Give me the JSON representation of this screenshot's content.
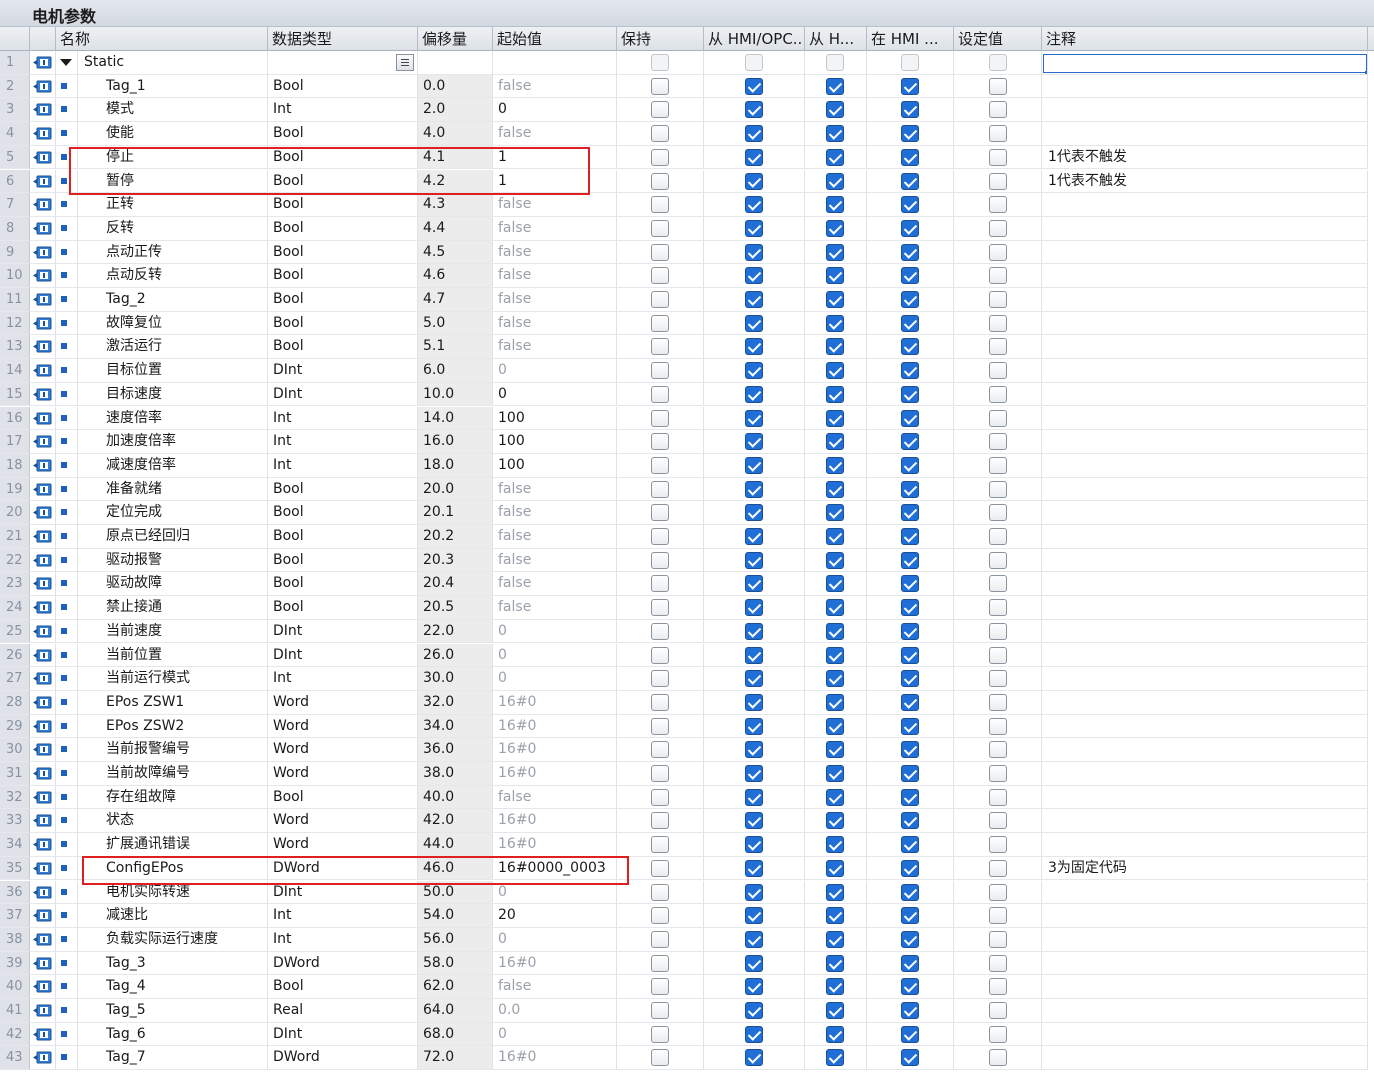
{
  "window": {
    "title": "电机参数"
  },
  "columns": {
    "name": "名称",
    "type": "数据类型",
    "offset": "偏移量",
    "start": "起始值",
    "retain": "保持",
    "hmi_access": "从 HMI/OPC..",
    "hmi_write": "从 H...",
    "hmi_visible": "在 HMI ...",
    "setpoint": "设定值",
    "comment": "注释"
  },
  "section_row": {
    "num": "1",
    "name": "Static"
  },
  "rows": [
    {
      "num": "2",
      "name": "Tag_1",
      "type": "Bool",
      "offset": "0.0",
      "start": "false",
      "comment": ""
    },
    {
      "num": "3",
      "name": "模式",
      "type": "Int",
      "offset": "2.0",
      "start": "0",
      "comment": ""
    },
    {
      "num": "4",
      "name": "使能",
      "type": "Bool",
      "offset": "4.0",
      "start": "false",
      "comment": ""
    },
    {
      "num": "5",
      "name": "停止",
      "type": "Bool",
      "offset": "4.1",
      "start": "1",
      "comment": "1代表不触发"
    },
    {
      "num": "6",
      "name": "暂停",
      "type": "Bool",
      "offset": "4.2",
      "start": "1",
      "comment": "1代表不触发"
    },
    {
      "num": "7",
      "name": "正转",
      "type": "Bool",
      "offset": "4.3",
      "start": "false",
      "comment": ""
    },
    {
      "num": "8",
      "name": "反转",
      "type": "Bool",
      "offset": "4.4",
      "start": "false",
      "comment": ""
    },
    {
      "num": "9",
      "name": "点动正传",
      "type": "Bool",
      "offset": "4.5",
      "start": "false",
      "comment": ""
    },
    {
      "num": "10",
      "name": "点动反转",
      "type": "Bool",
      "offset": "4.6",
      "start": "false",
      "comment": ""
    },
    {
      "num": "11",
      "name": "Tag_2",
      "type": "Bool",
      "offset": "4.7",
      "start": "false",
      "comment": ""
    },
    {
      "num": "12",
      "name": "故障复位",
      "type": "Bool",
      "offset": "5.0",
      "start": "false",
      "comment": ""
    },
    {
      "num": "13",
      "name": "激活运行",
      "type": "Bool",
      "offset": "5.1",
      "start": "false",
      "comment": ""
    },
    {
      "num": "14",
      "name": "目标位置",
      "type": "DInt",
      "offset": "6.0",
      "start": "0",
      "comment": ""
    },
    {
      "num": "15",
      "name": "目标速度",
      "type": "DInt",
      "offset": "10.0",
      "start": "0",
      "comment": ""
    },
    {
      "num": "16",
      "name": "速度倍率",
      "type": "Int",
      "offset": "14.0",
      "start": "100",
      "comment": ""
    },
    {
      "num": "17",
      "name": "加速度倍率",
      "type": "Int",
      "offset": "16.0",
      "start": "100",
      "comment": ""
    },
    {
      "num": "18",
      "name": "减速度倍率",
      "type": "Int",
      "offset": "18.0",
      "start": "100",
      "comment": ""
    },
    {
      "num": "19",
      "name": "准备就绪",
      "type": "Bool",
      "offset": "20.0",
      "start": "false",
      "comment": ""
    },
    {
      "num": "20",
      "name": "定位完成",
      "type": "Bool",
      "offset": "20.1",
      "start": "false",
      "comment": ""
    },
    {
      "num": "21",
      "name": "原点已经回归",
      "type": "Bool",
      "offset": "20.2",
      "start": "false",
      "comment": ""
    },
    {
      "num": "22",
      "name": "驱动报警",
      "type": "Bool",
      "offset": "20.3",
      "start": "false",
      "comment": ""
    },
    {
      "num": "23",
      "name": "驱动故障",
      "type": "Bool",
      "offset": "20.4",
      "start": "false",
      "comment": ""
    },
    {
      "num": "24",
      "name": "禁止接通",
      "type": "Bool",
      "offset": "20.5",
      "start": "false",
      "comment": ""
    },
    {
      "num": "25",
      "name": "当前速度",
      "type": "DInt",
      "offset": "22.0",
      "start": "0",
      "comment": ""
    },
    {
      "num": "26",
      "name": "当前位置",
      "type": "DInt",
      "offset": "26.0",
      "start": "0",
      "comment": ""
    },
    {
      "num": "27",
      "name": "当前运行模式",
      "type": "Int",
      "offset": "30.0",
      "start": "0",
      "comment": ""
    },
    {
      "num": "28",
      "name": "EPos ZSW1",
      "type": "Word",
      "offset": "32.0",
      "start": "16#0",
      "comment": ""
    },
    {
      "num": "29",
      "name": "EPos ZSW2",
      "type": "Word",
      "offset": "34.0",
      "start": "16#0",
      "comment": ""
    },
    {
      "num": "30",
      "name": "当前报警编号",
      "type": "Word",
      "offset": "36.0",
      "start": "16#0",
      "comment": ""
    },
    {
      "num": "31",
      "name": "当前故障编号",
      "type": "Word",
      "offset": "38.0",
      "start": "16#0",
      "comment": ""
    },
    {
      "num": "32",
      "name": "存在组故障",
      "type": "Bool",
      "offset": "40.0",
      "start": "false",
      "comment": ""
    },
    {
      "num": "33",
      "name": "状态",
      "type": "Word",
      "offset": "42.0",
      "start": "16#0",
      "comment": ""
    },
    {
      "num": "34",
      "name": "扩展通讯错误",
      "type": "Word",
      "offset": "44.0",
      "start": "16#0",
      "comment": ""
    },
    {
      "num": "35",
      "name": "ConfigEPos",
      "type": "DWord",
      "offset": "46.0",
      "start": "16#0000_0003",
      "comment": "3为固定代码"
    },
    {
      "num": "36",
      "name": "电机实际转速",
      "type": "DInt",
      "offset": "50.0",
      "start": "0",
      "comment": ""
    },
    {
      "num": "37",
      "name": "减速比",
      "type": "Int",
      "offset": "54.0",
      "start": "20",
      "comment": ""
    },
    {
      "num": "38",
      "name": "负载实际运行速度",
      "type": "Int",
      "offset": "56.0",
      "start": "0",
      "comment": ""
    },
    {
      "num": "39",
      "name": "Tag_3",
      "type": "DWord",
      "offset": "58.0",
      "start": "16#0",
      "comment": ""
    },
    {
      "num": "40",
      "name": "Tag_4",
      "type": "Bool",
      "offset": "62.0",
      "start": "false",
      "comment": ""
    },
    {
      "num": "41",
      "name": "Tag_5",
      "type": "Real",
      "offset": "64.0",
      "start": "0.0",
      "comment": ""
    },
    {
      "num": "42",
      "name": "Tag_6",
      "type": "DInt",
      "offset": "68.0",
      "start": "0",
      "comment": ""
    },
    {
      "num": "43",
      "name": "Tag_7",
      "type": "DWord",
      "offset": "72.0",
      "start": "16#0",
      "comment": ""
    }
  ],
  "start_dimmed": [
    "false",
    "0",
    "16#0",
    "0.0"
  ],
  "start_bold_rows": [
    "3",
    "5",
    "6",
    "15",
    "16",
    "17",
    "18",
    "35",
    "37"
  ],
  "checkbox_defaults": {
    "retain": false,
    "hmi_access": true,
    "hmi_write": true,
    "hmi_visible": true,
    "setpoint": false
  },
  "colors": {
    "highlight": "#e02020",
    "checkbox_on": "#1f6fd6",
    "header_bg": "#dde2e8"
  }
}
